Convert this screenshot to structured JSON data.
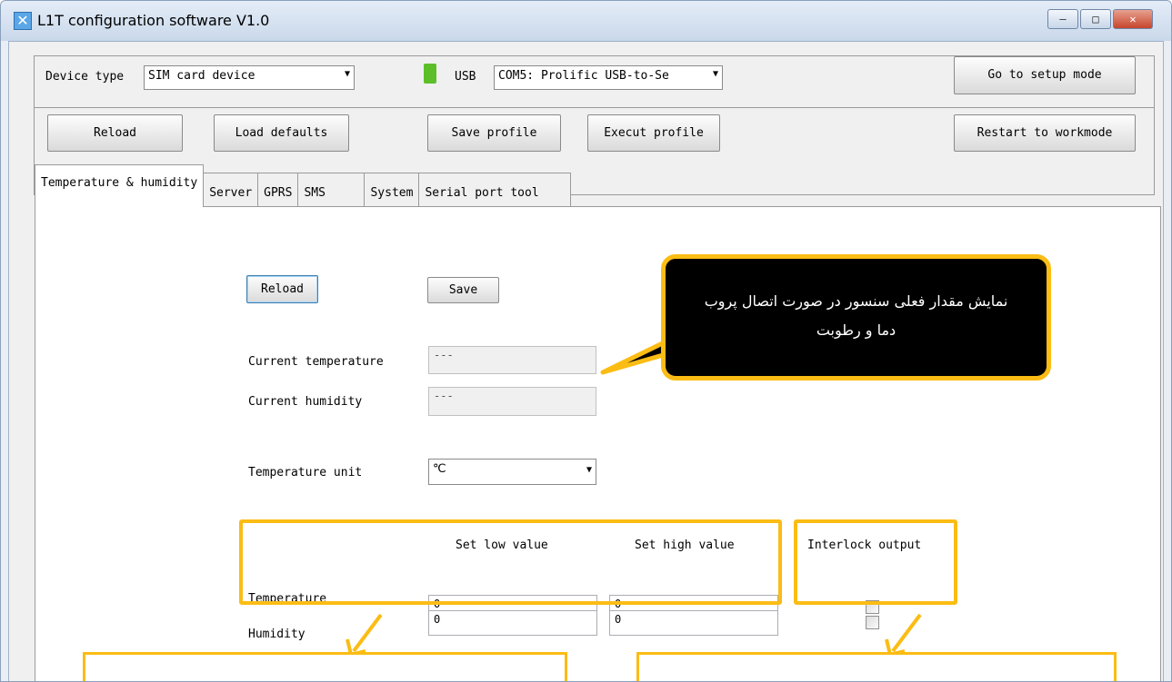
{
  "window": {
    "title": "L1T configuration software V1.0",
    "controls": {
      "minimize": "–",
      "maximize": "□",
      "close": "✕"
    }
  },
  "toolbar": {
    "device_type_label": "Device type",
    "device_type_value": "SIM card device",
    "usb_label": "USB",
    "port_value": "COM5: Prolific USB-to-Se",
    "setup_mode_button": "Go to setup mode",
    "reload_button": "Reload",
    "load_defaults_button": "Load defaults",
    "save_profile_button": "Save profile",
    "execute_profile_button": "Execut profile",
    "restart_button": "Restart to workmode"
  },
  "tabs": [
    {
      "label": "Temperature & humidity",
      "active": true
    },
    {
      "label": "Server",
      "active": false
    },
    {
      "label": "GPRS",
      "active": false
    },
    {
      "label": "SMS",
      "active": false
    },
    {
      "label": "System",
      "active": false
    },
    {
      "label": "Serial port tool",
      "active": false
    }
  ],
  "panel": {
    "reload_button": "Reload",
    "save_button": "Save",
    "current_temperature_label": "Current temperature",
    "current_temperature_value": "---",
    "current_humidity_label": "Current humidity",
    "current_humidity_value": "---",
    "temperature_unit_label": "Temperature unit",
    "temperature_unit_value": "℃",
    "col_low": "Set low value",
    "col_high": "Set high value",
    "col_interlock": "Interlock output",
    "rows": [
      {
        "label": "Temperature",
        "low": "0",
        "high": "0",
        "interlock": false
      },
      {
        "label": "Humidity",
        "low": "0",
        "high": "0",
        "interlock": false
      }
    ]
  },
  "annotation": {
    "callout_text": "نمایش مقدار فعلی سنسور در صورت اتصال پروب دما و رطوبت"
  },
  "colors": {
    "highlight": "#fbbc14",
    "callout_background": "#000000",
    "usb_icon": "#5cbf2a"
  },
  "icons": [
    "app-icon",
    "usb-icon",
    "dropdown-arrow-icon",
    "minimize-icon",
    "maximize-icon",
    "close-icon"
  ]
}
